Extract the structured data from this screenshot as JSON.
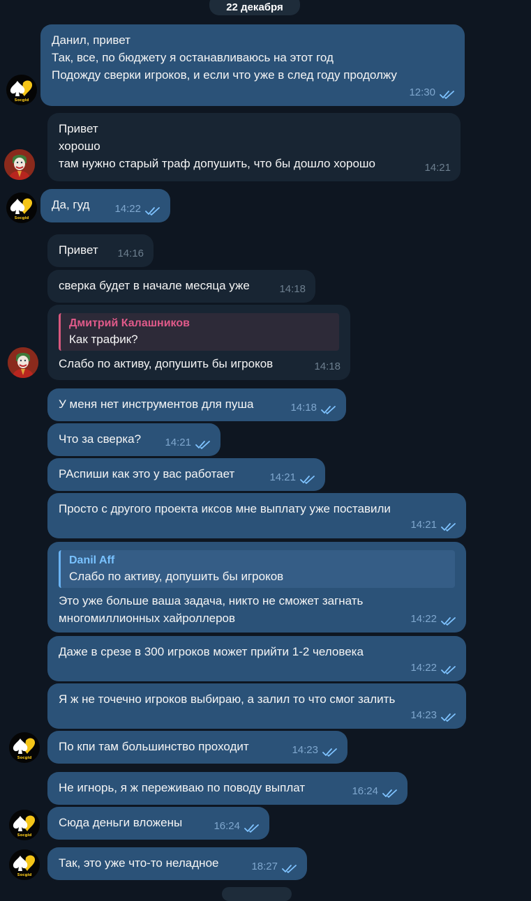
{
  "date_separator": "22 декабря",
  "messages": [
    {
      "dir": "out",
      "lines": [
        "Данил, привет",
        "Так, все, по бюджету я останавливаюсь на этот год",
        "Подожду сверки игроков, и если что уже в след году продолжу"
      ],
      "time": "12:30"
    },
    {
      "dir": "in",
      "lines": [
        "Привет",
        "хорошо",
        "там нужно старый траф допушить, что бы дошло хорошо"
      ],
      "time": "14:21"
    },
    {
      "dir": "out",
      "lines": [
        "Да, гуд"
      ],
      "time": "14:22"
    },
    {
      "dir": "in",
      "lines": [
        "Привет"
      ],
      "time": "14:16"
    },
    {
      "dir": "in",
      "lines": [
        "сверка будет в начале месяца уже"
      ],
      "time": "14:18"
    },
    {
      "dir": "in",
      "reply": {
        "name": "Дмитрий Калашников",
        "text": "Как трафик?"
      },
      "lines": [
        "Слабо по активу, допушить бы игроков"
      ],
      "time": "14:18"
    },
    {
      "dir": "out",
      "lines": [
        "У меня нет инструментов для пуша"
      ],
      "time": "14:18"
    },
    {
      "dir": "out",
      "lines": [
        "Что за сверка?"
      ],
      "time": "14:21"
    },
    {
      "dir": "out",
      "lines": [
        "РАспиши как это у вас работает"
      ],
      "time": "14:21"
    },
    {
      "dir": "out",
      "lines": [
        "Просто с другого проекта иксов мне выплату уже поставили"
      ],
      "time": "14:21"
    },
    {
      "dir": "out",
      "reply": {
        "name": "Danil Aff",
        "text": "Слабо по активу, допушить бы игроков"
      },
      "lines": [
        "Это уже больше ваша задача, никто не сможет загнать",
        "многомиллионных хайроллеров"
      ],
      "time": "14:22"
    },
    {
      "dir": "out",
      "lines": [
        "Даже в срезе в 300 игроков может прийти 1-2 человека"
      ],
      "time": "14:22"
    },
    {
      "dir": "out",
      "lines": [
        "Я ж не точечно игроков выбираю, а залил то что смог залить"
      ],
      "time": "14:23"
    },
    {
      "dir": "out",
      "lines": [
        "По кпи там большинство проходит"
      ],
      "time": "14:23"
    },
    {
      "dir": "out",
      "lines": [
        "Не игнорь, я ж переживаю по поводу выплат"
      ],
      "time": "16:24"
    },
    {
      "dir": "out",
      "lines": [
        "Сюда деньги вложены"
      ],
      "time": "16:24"
    },
    {
      "dir": "out",
      "lines": [
        "Так, это уже что-то неладное"
      ],
      "time": "18:27"
    }
  ],
  "avatars": [
    {
      "kind": "brand",
      "label": "Socgid"
    },
    {
      "kind": "joker",
      "label": ""
    }
  ],
  "colors": {
    "background": "#0e1621",
    "outgoing_bubble": "#2b5278",
    "incoming_bubble": "#182533",
    "read_check": "#7fc3ff",
    "reply_incoming_name": "#e05a8a",
    "reply_outgoing_name": "#79c2ff",
    "brand_yellow": "#f5c518"
  },
  "icons": {
    "read_receipt": "double-check-icon",
    "brand_avatar": "spade-heart-logo",
    "user_avatar": "joker-photo"
  }
}
